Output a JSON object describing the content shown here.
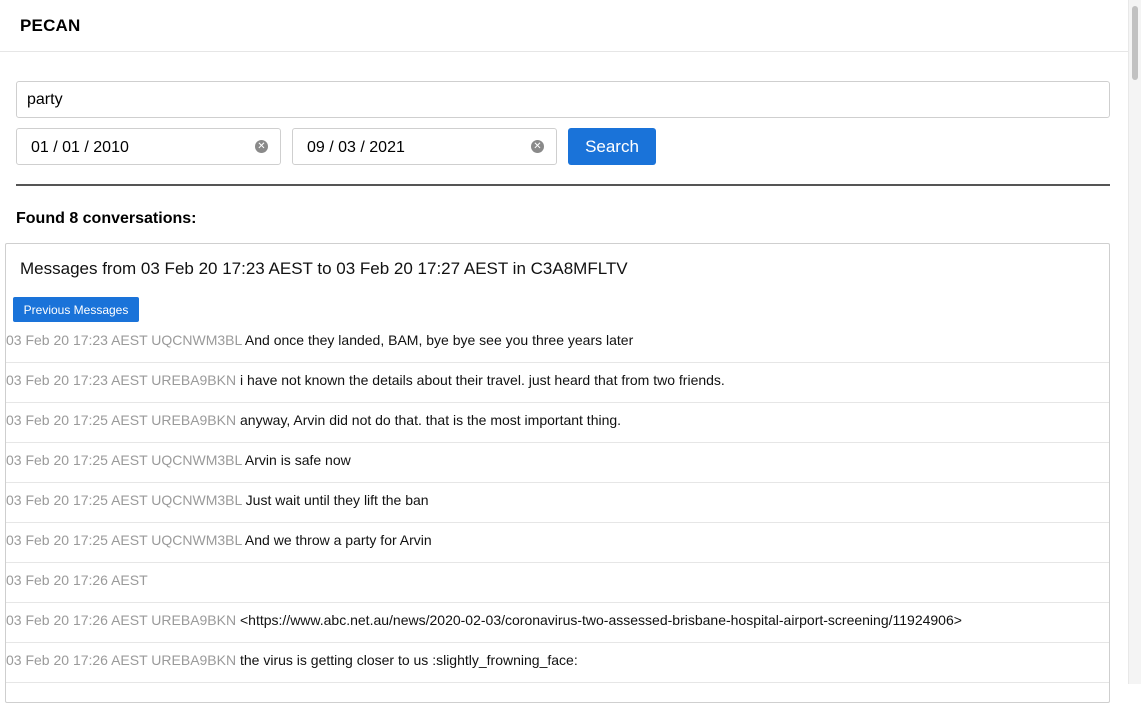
{
  "app": {
    "title": "PECAN"
  },
  "search": {
    "query": "party",
    "start_date": "01 / 01 / 2010",
    "end_date": "09 / 03 / 2021",
    "button_label": "Search"
  },
  "results": {
    "found_label": "Found 8 conversations:",
    "conversation": {
      "title": "Messages from 03 Feb 20 17:23 AEST to 03 Feb 20 17:27 AEST in C3A8MFLTV",
      "prev_button_label": "Previous Messages",
      "messages": [
        {
          "meta": "03 Feb 20 17:23 AEST UQCNWM3BL",
          "text": "And once they landed, BAM, bye bye see you three years later"
        },
        {
          "meta": "03 Feb 20 17:23 AEST UREBA9BKN",
          "text": "i have not known the details about their travel. just heard that from two friends."
        },
        {
          "meta": "03 Feb 20 17:25 AEST UREBA9BKN",
          "text": "anyway, Arvin did not do that. that is the most important thing."
        },
        {
          "meta": "03 Feb 20 17:25 AEST UQCNWM3BL",
          "text": "Arvin is safe now"
        },
        {
          "meta": "03 Feb 20 17:25 AEST UQCNWM3BL",
          "text": "Just wait until they lift the ban"
        },
        {
          "meta": "03 Feb 20 17:25 AEST UQCNWM3BL",
          "text": "And we throw a party for Arvin"
        },
        {
          "meta": "03 Feb 20 17:26 AEST",
          "text": ""
        },
        {
          "meta": "03 Feb 20 17:26 AEST UREBA9BKN",
          "text": "<https://www.abc.net.au/news/2020-02-03/coronavirus-two-assessed-brisbane-hospital-airport-screening/11924906>"
        },
        {
          "meta": "03 Feb 20 17:26 AEST UREBA9BKN",
          "text": "the virus is getting closer to us :slightly_frowning_face:"
        }
      ]
    }
  },
  "icons": {
    "clear": "clear-circle-icon"
  },
  "colors": {
    "accent": "#1a73d9",
    "meta_text": "#9a9a9a"
  }
}
